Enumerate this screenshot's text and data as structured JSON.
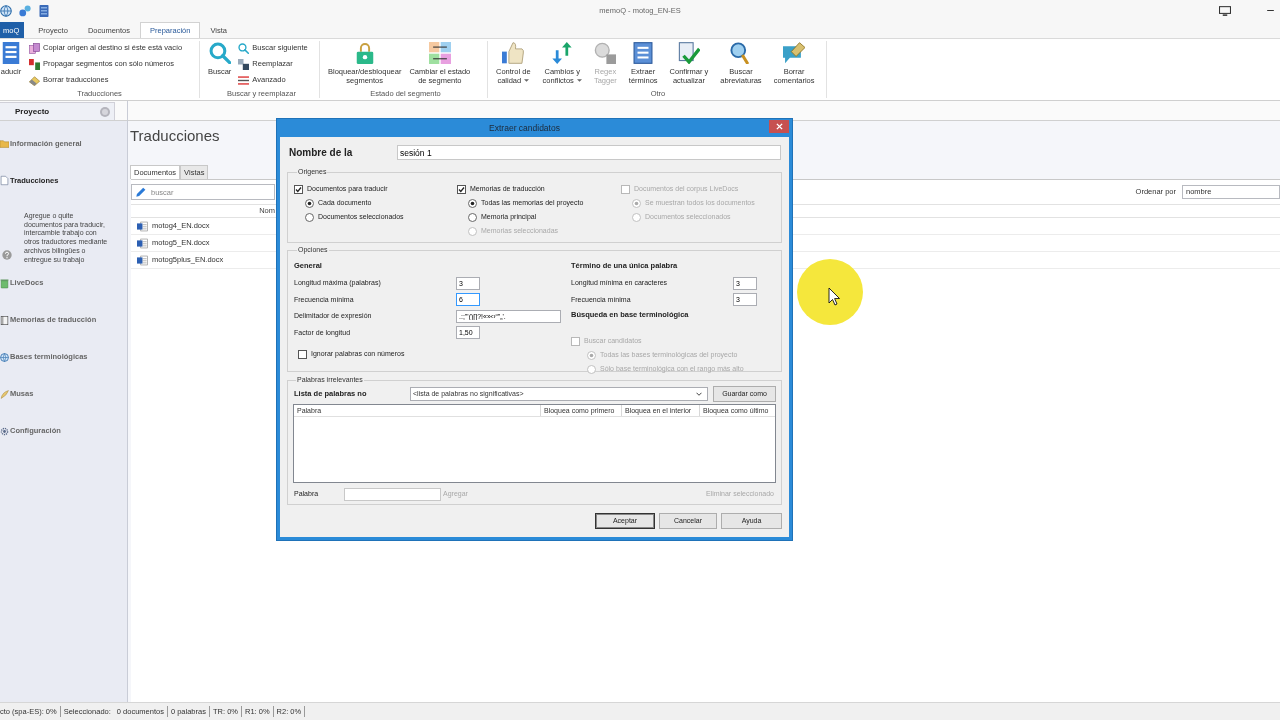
{
  "title_bar": {
    "title": "memoQ - motog_EN-ES"
  },
  "ribbon_tabs": [
    {
      "label": "moQ",
      "kind": "file",
      "selected": false
    },
    {
      "label": "Proyecto",
      "kind": "tab",
      "selected": false
    },
    {
      "label": "Documentos",
      "kind": "tab",
      "selected": false
    },
    {
      "label": "Preparación",
      "kind": "tab",
      "selected": true
    },
    {
      "label": "Vista",
      "kind": "tab",
      "selected": false
    }
  ],
  "ribbon_groups": [
    {
      "label": "Traducciones",
      "buttons": [
        {
          "kind": "large",
          "label": "aducir",
          "disabled": false,
          "dropdown": false
        },
        {
          "kind": "small",
          "label": "Copiar origen al destino si éste está vacío",
          "disabled": false,
          "dropdown": false
        },
        {
          "kind": "small",
          "label": "Propagar segmentos con sólo números",
          "disabled": false,
          "dropdown": false
        },
        {
          "kind": "small",
          "label": "Borrar traducciones",
          "disabled": false,
          "dropdown": false
        }
      ]
    },
    {
      "label": "Buscar y reemplazar",
      "buttons": [
        {
          "kind": "large",
          "label": "Buscar",
          "disabled": false,
          "dropdown": false
        },
        {
          "kind": "small",
          "label": "Buscar siguiente",
          "disabled": false,
          "dropdown": false
        },
        {
          "kind": "small",
          "label": "Reemplazar",
          "disabled": false,
          "dropdown": false
        },
        {
          "kind": "small",
          "label": "Avanzado",
          "disabled": false,
          "dropdown": false
        }
      ]
    },
    {
      "label": "Estado del segmento",
      "buttons": [
        {
          "kind": "large",
          "label": "Bloquear/desbloquear\nsegmentos",
          "disabled": false,
          "dropdown": false
        },
        {
          "kind": "large",
          "label": "Cambiar el estado\nde segmento",
          "disabled": false,
          "dropdown": false
        }
      ]
    },
    {
      "label": "Otro",
      "buttons": [
        {
          "kind": "large",
          "label": "Control de\ncalidad",
          "disabled": false,
          "dropdown": true
        },
        {
          "kind": "large",
          "label": "Cambios y\nconflictos",
          "disabled": false,
          "dropdown": true
        },
        {
          "kind": "large",
          "label": "Regex\nTagger",
          "disabled": true,
          "dropdown": false
        },
        {
          "kind": "large",
          "label": "Extraer\ntérminos",
          "disabled": false,
          "dropdown": false
        },
        {
          "kind": "large",
          "label": "Confirmar y\nactualizar",
          "disabled": false,
          "dropdown": false
        },
        {
          "kind": "large",
          "label": "Buscar\nabreviaturas",
          "disabled": false,
          "dropdown": false
        },
        {
          "kind": "large",
          "label": "Borrar\ncomentarios",
          "disabled": false,
          "dropdown": false
        }
      ]
    }
  ],
  "panel": {
    "title": "Proyecto",
    "items": [
      {
        "label": "Información general",
        "selected": false
      },
      {
        "label": "Traducciones",
        "selected": true,
        "description": "Agregue o quite documentos para traducir, intercambie trabajo con otros traductores mediante archivos bilingües o entregue su trabajo"
      },
      {
        "label": "LiveDocs",
        "selected": false
      },
      {
        "label": "Memorias de traducción",
        "selected": false
      },
      {
        "label": "Bases terminológicas",
        "selected": false
      },
      {
        "label": "Musas",
        "selected": false
      },
      {
        "label": "Configuración",
        "selected": false
      }
    ]
  },
  "main": {
    "title": "Traducciones",
    "tabs": [
      {
        "label": "Documentos",
        "selected": true
      },
      {
        "label": "Vistas",
        "selected": false
      }
    ],
    "search": {
      "placeholder": "buscar"
    },
    "sort": {
      "label": "Ordenar por",
      "value": "nombre"
    },
    "table": {
      "columns": [
        "Nom"
      ],
      "rows": [
        [
          "motog4_EN.docx"
        ],
        [
          "motog5_EN.docx"
        ],
        [
          "motog5plus_EN.docx"
        ]
      ]
    }
  },
  "dialog": {
    "title": "Extraer candidatos",
    "session": {
      "label": "Nombre de la",
      "value": "sesión 1"
    },
    "sources": {
      "label": "Origenes",
      "columns": [
        {
          "checkbox": {
            "label": "Documentos para traducir",
            "checked": true,
            "disabled": false
          },
          "options": [
            {
              "label": "Cada documento",
              "selected": true,
              "disabled": false
            },
            {
              "label": "Documentos seleccionados",
              "selected": false,
              "disabled": false
            }
          ]
        },
        {
          "checkbox": {
            "label": "Memorias de traducción",
            "checked": true,
            "disabled": false
          },
          "options": [
            {
              "label": "Todas las memorias del proyecto",
              "selected": true,
              "disabled": false
            },
            {
              "label": "Memoria principal",
              "selected": false,
              "disabled": false
            },
            {
              "label": "Memorias seleccionadas",
              "selected": false,
              "disabled": true
            }
          ]
        },
        {
          "checkbox": {
            "label": "Documentos del corpus LiveDocs",
            "checked": false,
            "disabled": true
          },
          "options": [
            {
              "label": "Se muestran todos los documentos",
              "selected": true,
              "disabled": true
            },
            {
              "label": "Documentos seleccionados",
              "selected": false,
              "disabled": true
            }
          ]
        }
      ]
    },
    "options": {
      "label": "Opciones",
      "general": {
        "heading": "General",
        "fields": [
          {
            "label": "Longitud máxima (palabras)",
            "value": "3",
            "kind": "number",
            "focused": false
          },
          {
            "label": "Frecuencia mínima",
            "value": "6",
            "kind": "number",
            "focused": true
          },
          {
            "label": "Delimitador de expresión",
            "value": ".:;\"'()[]?!«»‹›“”„'.",
            "kind": "text",
            "focused": false
          },
          {
            "label": "Factor de longitud",
            "value": "1,50",
            "kind": "number",
            "focused": false
          }
        ],
        "checkbox": {
          "label": "Ignorar palabras con números",
          "checked": false,
          "disabled": false
        }
      },
      "single_word": {
        "heading": "Término de una única palabra",
        "fields": [
          {
            "label": "Longitud mínima en caracteres",
            "value": "3",
            "kind": "number",
            "focused": false
          },
          {
            "label": "Frecuencia mínima",
            "value": "3",
            "kind": "number",
            "focused": false
          }
        ]
      },
      "termbase": {
        "heading": "Búsqueda en base terminológica",
        "checkbox": {
          "label": "Buscar candidatos",
          "checked": false,
          "disabled": true
        },
        "options": [
          {
            "label": "Todas las bases terminológicas del proyecto",
            "selected": true,
            "disabled": true
          },
          {
            "label": "Sólo base terminológica con el rango más alto",
            "selected": false,
            "disabled": true
          }
        ]
      }
    },
    "stopwords": {
      "label": "Palabras irrelevantes",
      "list_label": "Lista de palabras no",
      "list_value": "<lista de palabras no significativas>",
      "save_button": "Guardar como",
      "columns": [
        "Palabra",
        "Bloquea como primero",
        "Bloquea en el interior",
        "Bloquea como último"
      ],
      "word_label": "Palabra",
      "add": {
        "label": "Agregar",
        "disabled": true
      },
      "remove": {
        "label": "Eliminar seleccionado",
        "disabled": true
      }
    },
    "buttons": [
      {
        "label": "Aceptar",
        "default": true
      },
      {
        "label": "Cancelar",
        "default": false
      },
      {
        "label": "Ayuda",
        "default": false
      }
    ]
  },
  "status_bar": {
    "groups": [
      [
        "cto (spa-ES): 0%"
      ],
      [
        "Seleccionado:",
        "0 documentos"
      ],
      [
        "0 palabras"
      ],
      [
        "TR: 0%"
      ],
      [
        "R1: 0%"
      ],
      [
        "R2: 0%"
      ]
    ]
  }
}
